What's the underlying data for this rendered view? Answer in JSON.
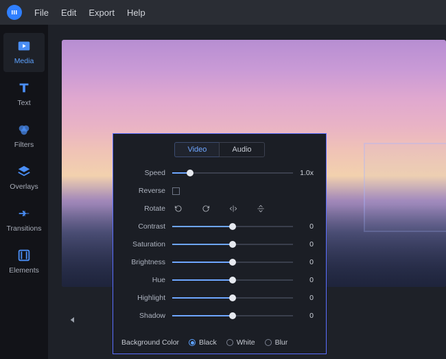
{
  "menubar": {
    "items": [
      "File",
      "Edit",
      "Export",
      "Help"
    ]
  },
  "sidebar": {
    "items": [
      {
        "label": "Media",
        "icon": "play-folder-icon",
        "active": true
      },
      {
        "label": "Text",
        "icon": "text-icon",
        "active": false
      },
      {
        "label": "Filters",
        "icon": "filters-icon",
        "active": false
      },
      {
        "label": "Overlays",
        "icon": "overlays-icon",
        "active": false
      },
      {
        "label": "Transitions",
        "icon": "transitions-icon",
        "active": false
      },
      {
        "label": "Elements",
        "icon": "elements-icon",
        "active": false
      }
    ]
  },
  "panel": {
    "tabs": [
      {
        "label": "Video",
        "active": true
      },
      {
        "label": "Audio",
        "active": false
      }
    ],
    "speed": {
      "label": "Speed",
      "value_text": "1.0x",
      "position": 0.15
    },
    "reverse": {
      "label": "Reverse",
      "checked": false
    },
    "rotate": {
      "label": "Rotate",
      "buttons": [
        "rotate-ccw-icon",
        "rotate-cw-icon",
        "flip-horizontal-icon",
        "flip-vertical-icon"
      ]
    },
    "sliders": [
      {
        "label": "Contrast",
        "value": 0,
        "position": 0.5
      },
      {
        "label": "Saturation",
        "value": 0,
        "position": 0.5
      },
      {
        "label": "Brightness",
        "value": 0,
        "position": 0.5
      },
      {
        "label": "Hue",
        "value": 0,
        "position": 0.5
      },
      {
        "label": "Highlight",
        "value": 0,
        "position": 0.5
      },
      {
        "label": "Shadow",
        "value": 0,
        "position": 0.5
      }
    ],
    "bgcolor": {
      "label": "Background Color",
      "options": [
        {
          "label": "Black",
          "checked": true
        },
        {
          "label": "White",
          "checked": false
        },
        {
          "label": "Blur",
          "checked": false
        }
      ]
    }
  }
}
